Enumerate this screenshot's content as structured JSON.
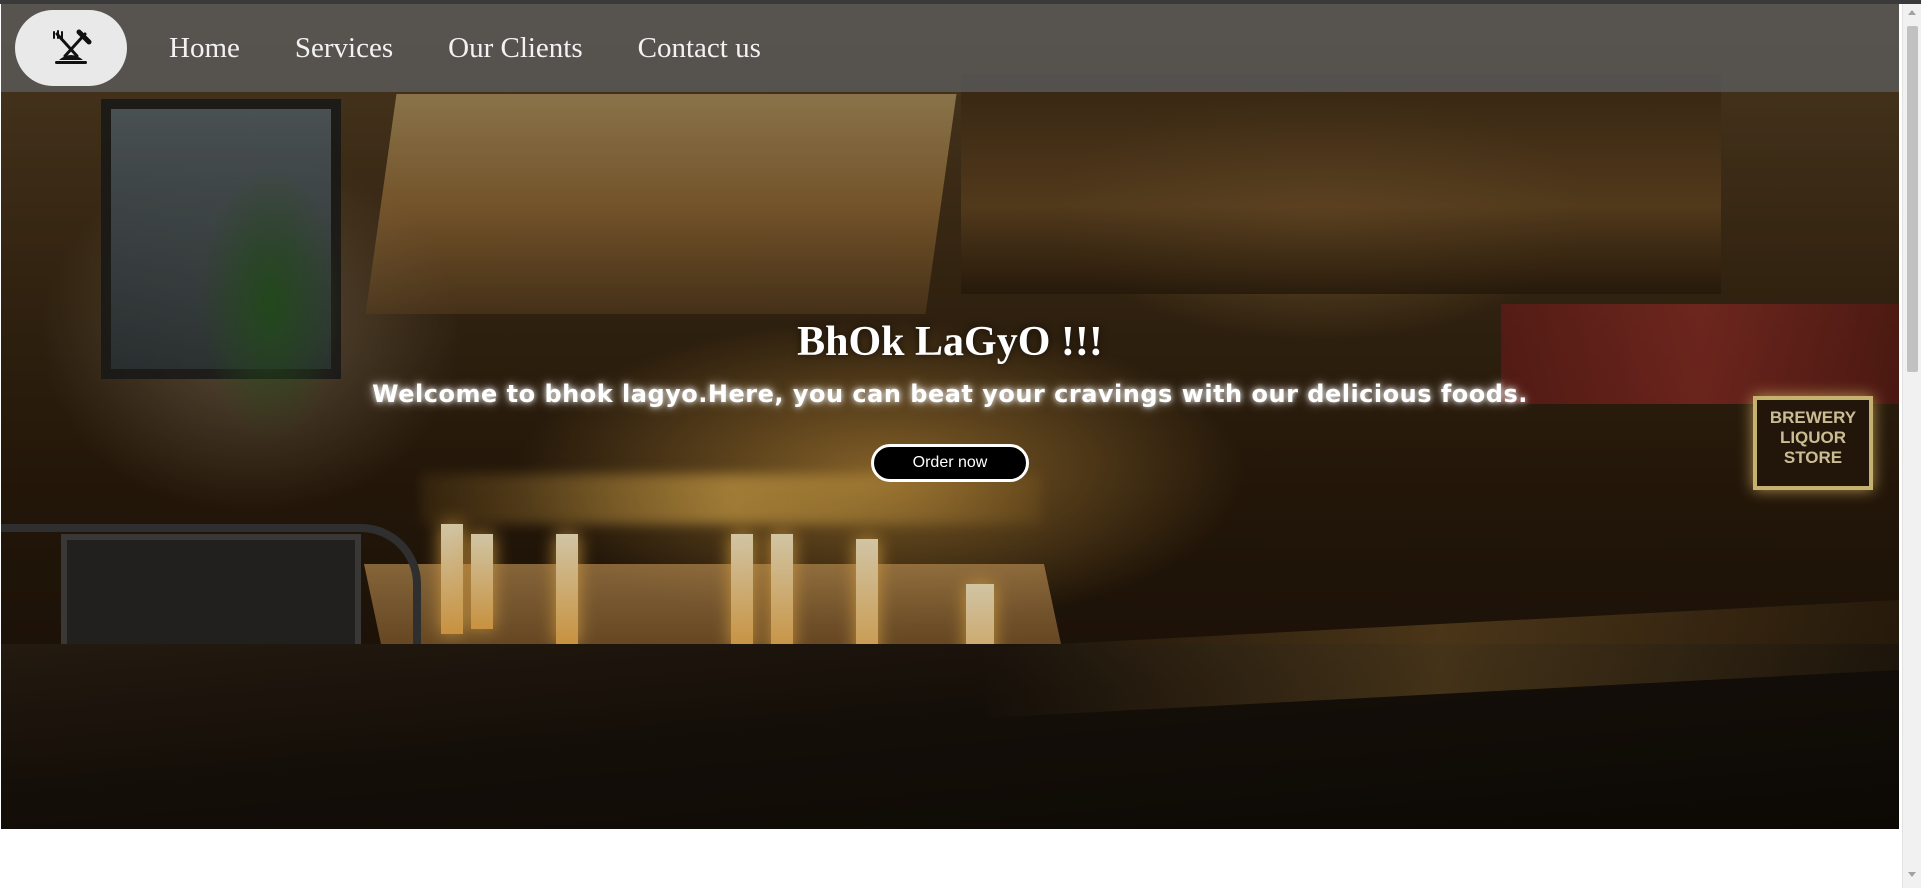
{
  "nav": {
    "logo_icon": "fork-knife-plate-icon",
    "items": [
      {
        "label": "Home"
      },
      {
        "label": "Services"
      },
      {
        "label": "Our Clients"
      },
      {
        "label": "Contact us"
      }
    ]
  },
  "hero": {
    "title": "BhOk LaGyO !!!",
    "subtitle": "Welcome to bhok lagyo.Here, you can beat your cravings with our delicious foods.",
    "cta_label": "Order now",
    "sign_text": "BREWERY LIQUOR STORE"
  },
  "colors": {
    "navbar_bg": "#5a5a5a",
    "button_bg": "#000000",
    "button_border": "#ffffff",
    "text": "#ffffff"
  }
}
